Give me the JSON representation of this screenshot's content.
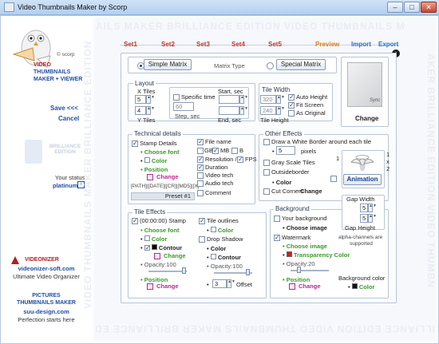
{
  "window": {
    "title": "Video Thumbnails Maker by Scorp",
    "minimize": "–",
    "maximize": "□",
    "close": "✕"
  },
  "sidebar": {
    "copyright": "© scorp",
    "product_line1": "VIDEO",
    "product_line2": "THUMBNAILS",
    "product_line3": "MAKER + VIEWER",
    "save": "Save <<<",
    "cancel": "Cancel",
    "edition": "BRILLIANCE EDITION",
    "status_label": "Your status",
    "status_value": "platinum",
    "promo1_title": "VIDEONIZER",
    "promo1_url": "videonizer-soft.com",
    "promo1_tag": "Ultimate Video Organizer",
    "promo2_title1": "PICTURES",
    "promo2_title2": "THUMBNAILS MAKER",
    "promo2_url": "suu-design.com",
    "promo2_tag": "Perfection starts here"
  },
  "watermark": {
    "top": "AILS MAKER BRILLIANCE EDITION VIDEO THUMBNAILS M",
    "bottom": "ILLIANCE EDITION VIDEO THUMBNAILS MAKER BRILLIANCE EDITION VIDEO",
    "left": "VIDEO THUMBNAILS MAKER BRILLIANCE EDITION",
    "right": "AKER BRILLIANCE EDITION VIDEO THUMBN"
  },
  "steps": [
    "Set1",
    "Set2",
    "Set3",
    "Set4",
    "Set5",
    "Preview",
    "Import",
    "Export"
  ],
  "matrix": {
    "simple": "Simple Matrix",
    "type_label": "Matrix Type",
    "special": "Special Matrix",
    "preview_caption": "Sync",
    "change": "Change"
  },
  "layout": {
    "title": "Layout",
    "x_tiles_label": "X Tiles",
    "x_tiles": "5",
    "y_tiles": "4",
    "y_tiles_label": "Y Tiles",
    "specific_time": "Specific time",
    "start": "Start, sec",
    "start_value": "",
    "step_value": "60",
    "step": "Step, sec",
    "end_value": "",
    "end": "End, sec"
  },
  "tile": {
    "width_label": "Tile Width",
    "width": "320",
    "height": "240",
    "height_label": "Tile Height",
    "auto_height": "Auto Height",
    "fit_screen": "Fit Screen",
    "as_original": "As Original"
  },
  "technical": {
    "title": "Technical details",
    "stamp_details": "Stamp Details",
    "choose_font": "Choose font",
    "color": "Color",
    "position": "Position",
    "change": "Change",
    "template": "[PATH]|[DATE]|[CR]|[MD5]|[X]",
    "preset": "Preset #1",
    "file_name": "File name",
    "gb": "GB",
    "mb": "MB",
    "b": "B",
    "resolution": "Resolution /",
    "fps": "FPS",
    "duration": "Duration",
    "video_tech": "Video tech",
    "audio_tech": "Audio tech",
    "comment": "Comment"
  },
  "other": {
    "title": "Other Effects",
    "draw_border": "Draw a White Border around each tile",
    "pixels_value": "5",
    "pixels": "pixels",
    "gray": "Gray Scale Tiles",
    "outside_border": "Outsideborder",
    "color": "Color",
    "cut_corners": "Cut Corners",
    "change": "Change",
    "anim_caption1": "1",
    "anim_caption2": "1",
    "anim_x": "x",
    "anim_2": "2",
    "animation": "Animation"
  },
  "tile_effects": {
    "title": "Tile Effects",
    "stamp": "(00:00:00) Stamp",
    "choose_font": "Choose font",
    "color": "Color",
    "contour": "Contour",
    "change": "Change",
    "opacity": "Opacity:100",
    "position": "Position",
    "change2": "Change",
    "outlines": "Tile outlines",
    "color2": "Color",
    "drop_shadow": "Drop Shadow",
    "color3": "Color",
    "contour2": "Contour",
    "opacity2": "Opacity:100",
    "offset_value": "3",
    "offset": "Offset"
  },
  "background": {
    "title": "Background",
    "your_background": "Your background",
    "choose_image": "Choose image",
    "watermark": "Watermark",
    "choose_image2": "Choose image",
    "transparency": "Transparency Color",
    "opacity": "Opacity:20",
    "position": "Position",
    "change": "Change",
    "gap_width": "Gap Width",
    "gap_w": "5",
    "gap_h": "5",
    "gap_height": "Gap Height",
    "alpha_note1": "alpha-channels are",
    "alpha_note2": "supported",
    "bg_color": "Background color",
    "color": "Color"
  }
}
